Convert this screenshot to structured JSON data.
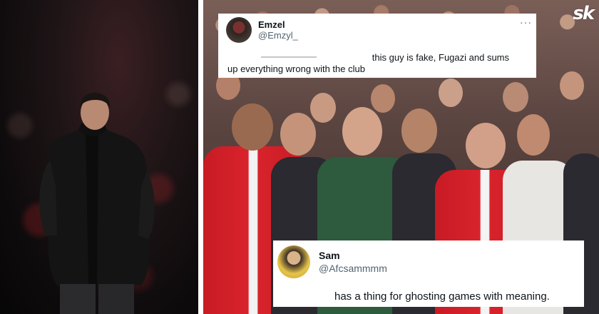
{
  "brand": {
    "logo_text": "sk"
  },
  "tweets": [
    {
      "name": "Emzel",
      "handle": "@Emzyl_",
      "more": "···",
      "lines": [
        "this guy is fake, Fugazi and sums",
        "up everything wrong with the club"
      ]
    },
    {
      "name": "Sam",
      "handle": "@Afcsammmm",
      "lines": [
        "has a thing for ghosting games with meaning."
      ]
    }
  ],
  "colors": {
    "arsenal_red": "#d6222b",
    "card_bg": "#ffffff",
    "handle_gray": "#536471"
  }
}
